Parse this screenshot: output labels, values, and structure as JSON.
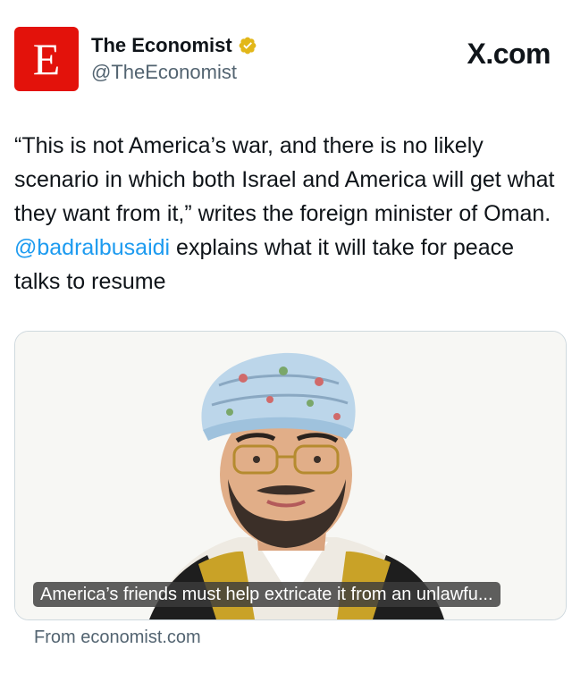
{
  "header": {
    "logo_letter": "E",
    "display_name": "The Economist",
    "handle": "@TheEconomist",
    "source_label": "X.com"
  },
  "tweet": {
    "text_before": "“This is not America’s war, and there is no likely scenario in which both Israel and America will get what they want from it,” writes the foreign minister of Oman. ",
    "mention": "@badralbusaidi",
    "text_after": " explains what it will take for peace talks to resume"
  },
  "card": {
    "image_description_icon": "portrait-illustration",
    "caption": "America’s friends must help extricate it from an unlawfu...",
    "from_label": "From economist.com"
  },
  "colors": {
    "brand_red": "#e3120b",
    "verified_gold": "#e2b719",
    "link_blue": "#1d9bf0",
    "secondary_text": "#536471"
  }
}
